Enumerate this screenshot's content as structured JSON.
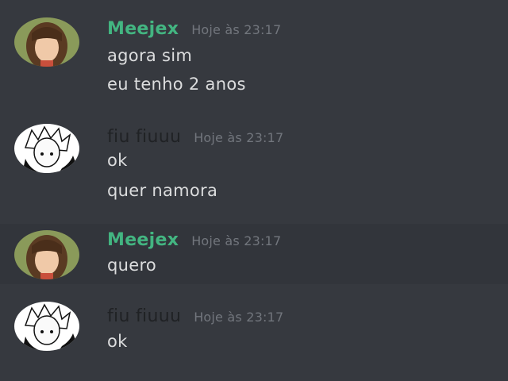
{
  "colors": {
    "background": "#36393f",
    "hover_background": "#32353b",
    "meejex_name": "#43b581",
    "fiu_name": "#202225",
    "timestamp": "#72767d",
    "message_text": "#dcddde"
  },
  "messages": [
    {
      "author": "Meejex",
      "timestamp": "Hoje às 23:17",
      "lines": [
        "agora sim",
        "eu tenho 2 anos"
      ],
      "avatar_icon": "anime-girl-avatar-icon"
    },
    {
      "author": "fiu fiuuu",
      "timestamp": "Hoje às 23:17",
      "lines": [
        "ok",
        "quer namora"
      ],
      "avatar_icon": "anime-boy-avatar-icon"
    },
    {
      "author": "Meejex",
      "timestamp": "Hoje às 23:17",
      "lines": [
        "quero"
      ],
      "avatar_icon": "anime-girl-avatar-icon"
    },
    {
      "author": "fiu fiuuu",
      "timestamp": "Hoje às 23:17",
      "lines": [
        "ok"
      ],
      "avatar_icon": "anime-boy-avatar-icon"
    }
  ]
}
